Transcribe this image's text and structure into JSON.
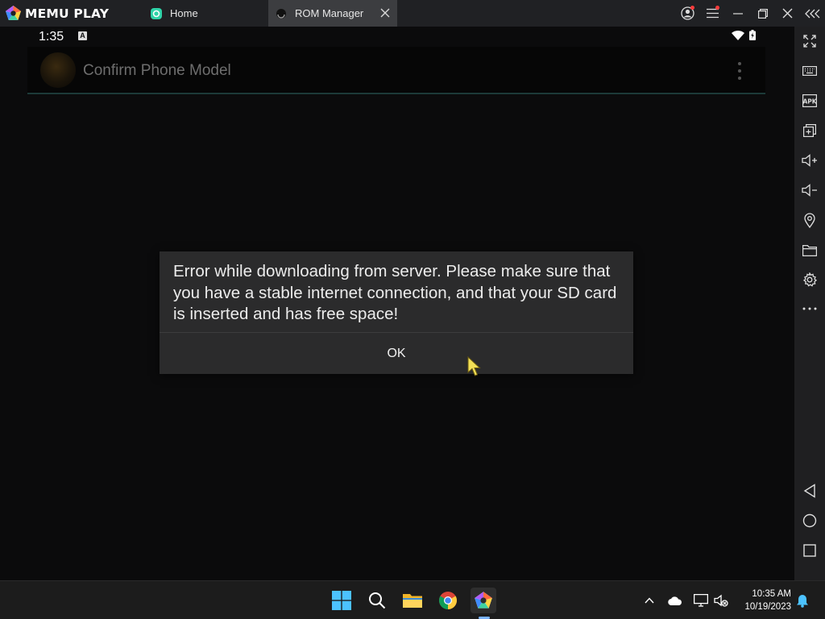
{
  "emulator": {
    "brand": "MEMU PLAY",
    "tabs": [
      {
        "label": "Home"
      },
      {
        "label": "ROM Manager"
      }
    ]
  },
  "android": {
    "status": {
      "time": "1:35",
      "notif_letter": "A"
    },
    "actionbar": {
      "title": "Confirm Phone Model"
    },
    "dialog": {
      "message": "Error while downloading from server. Please make sure that you have a stable internet connection, and that your SD card is inserted and has free space!",
      "button": "OK"
    }
  },
  "sidebar": {
    "icons": [
      "fullscreen-icon",
      "keyboard-icon",
      "apk-icon",
      "multi-instance-icon",
      "volume-up-icon",
      "volume-down-icon",
      "location-icon",
      "folder-icon",
      "settings-icon",
      "more-icon",
      "back-icon",
      "home-icon",
      "recents-icon"
    ],
    "apk_label": "APK"
  },
  "taskbar": {
    "time": "10:35 AM",
    "date": "10/19/2023"
  },
  "colors": {
    "titlebar": "#202124",
    "active_tab": "#3c3d40",
    "dialog_bg": "#2b2b2c",
    "accent_line": "#1c3a38",
    "notification_dot": "#ff3b3b"
  }
}
